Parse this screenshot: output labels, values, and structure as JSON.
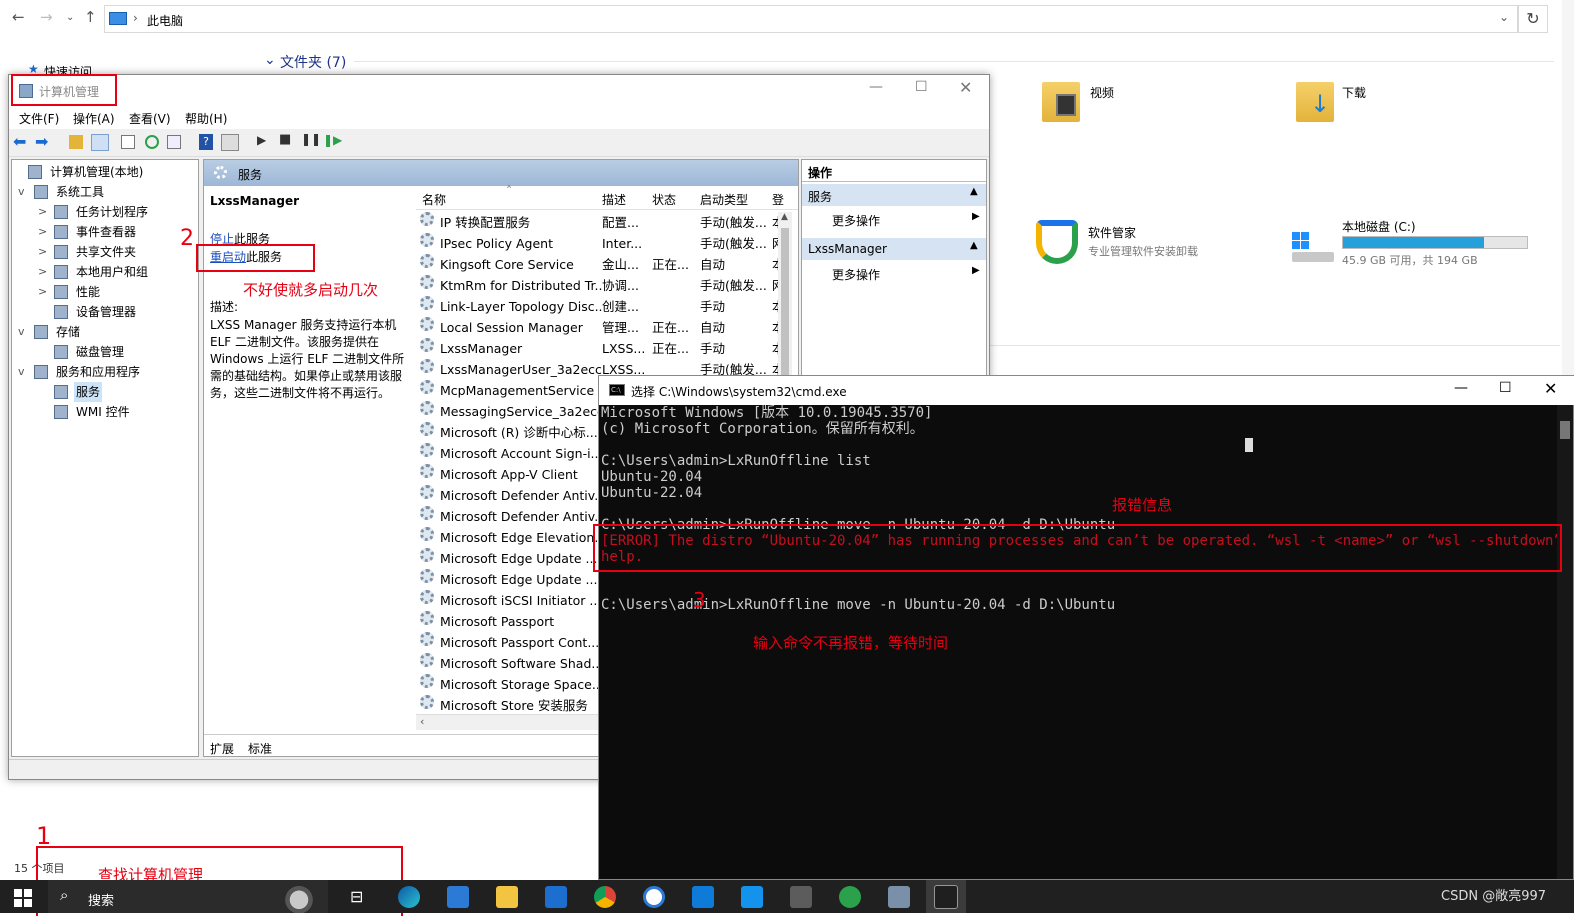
{
  "explorer": {
    "address": "此电脑",
    "folders_header": "文件夹 (7)",
    "quick_access": "快速访问",
    "items": [
      {
        "label": "视频",
        "icon": "video-folder-icon"
      },
      {
        "label": "下载",
        "icon": "download-folder-icon"
      },
      {
        "label": "软件管家",
        "sub": "专业管理软件安装卸载",
        "icon": "software-manager-icon"
      },
      {
        "label": "本地磁盘 (C:)",
        "sub": "45.9 GB 可用，共 194 GB",
        "usage_fraction": 0.764,
        "icon": "hard-disk-icon"
      }
    ],
    "status_count": "15 个项目"
  },
  "mmc": {
    "title": "计算机管理",
    "menu": [
      "文件(F)",
      "操作(A)",
      "查看(V)",
      "帮助(H)"
    ],
    "tree": [
      {
        "label": "计算机管理(本地)",
        "level": 0,
        "icon": "computer-management-icon",
        "expander": ""
      },
      {
        "label": "系统工具",
        "level": 1,
        "icon": "system-tools-icon",
        "expander": "v"
      },
      {
        "label": "任务计划程序",
        "level": 2,
        "icon": "task-scheduler-icon",
        "expander": ">"
      },
      {
        "label": "事件查看器",
        "level": 2,
        "icon": "event-viewer-icon",
        "expander": ">"
      },
      {
        "label": "共享文件夹",
        "level": 2,
        "icon": "shared-folder-icon",
        "expander": ">"
      },
      {
        "label": "本地用户和组",
        "level": 2,
        "icon": "users-icon",
        "expander": ">"
      },
      {
        "label": "性能",
        "level": 2,
        "icon": "performance-icon",
        "expander": ">"
      },
      {
        "label": "设备管理器",
        "level": 2,
        "icon": "device-manager-icon",
        "expander": ""
      },
      {
        "label": "存储",
        "level": 1,
        "icon": "storage-icon",
        "expander": "v"
      },
      {
        "label": "磁盘管理",
        "level": 2,
        "icon": "disk-management-icon",
        "expander": ""
      },
      {
        "label": "服务和应用程序",
        "level": 1,
        "icon": "services-apps-icon",
        "expander": "v"
      },
      {
        "label": "服务",
        "level": 2,
        "icon": "services-icon",
        "expander": "",
        "selected": true
      },
      {
        "label": "WMI 控件",
        "level": 2,
        "icon": "wmi-icon",
        "expander": ""
      }
    ],
    "services_header": "服务",
    "selected_service": "LxssManager",
    "stop_link": "停止",
    "stop_suffix": "此服务",
    "restart_link": "重启动",
    "restart_suffix": "此服务",
    "desc_label": "描述:",
    "desc_lines": [
      "LXSS Manager 服务支持运行本机",
      "ELF 二进制文件。该服务提供在",
      "Windows 上运行 ELF 二进制文件所",
      "需的基础结构。如果停止或禁用该服",
      "务，这些二进制文件将不再运行。"
    ],
    "columns": [
      "名称",
      "描述",
      "状态",
      "启动类型",
      "登"
    ],
    "rows": [
      [
        "IP 转换配置服务",
        "配置...",
        "",
        "手动(触发...",
        "本"
      ],
      [
        "IPsec Policy Agent",
        "Inter...",
        "",
        "手动(触发...",
        "网"
      ],
      [
        "Kingsoft Core Service",
        "金山...",
        "正在...",
        "自动",
        "本"
      ],
      [
        "KtmRm for Distributed Tr...",
        "协调...",
        "",
        "手动(触发...",
        "网"
      ],
      [
        "Link-Layer Topology Disc...",
        "创建...",
        "",
        "手动",
        "本"
      ],
      [
        "Local Session Manager",
        "管理...",
        "正在...",
        "自动",
        "本"
      ],
      [
        "LxssManager",
        "LXSS...",
        "正在...",
        "手动",
        "本"
      ],
      [
        "LxssManagerUser_3a2ecc",
        "LXSS...",
        "",
        "手动(触发...",
        "本"
      ],
      [
        "McpManagementService",
        "",
        "",
        "",
        ""
      ],
      [
        "MessagingService_3a2ecc",
        "",
        "",
        "",
        ""
      ],
      [
        "Microsoft (R) 诊断中心标...",
        "",
        "",
        "",
        ""
      ],
      [
        "Microsoft Account Sign-i...",
        "",
        "",
        "",
        ""
      ],
      [
        "Microsoft App-V Client",
        "",
        "",
        "",
        ""
      ],
      [
        "Microsoft Defender Antiv...",
        "",
        "",
        "",
        ""
      ],
      [
        "Microsoft Defender Antiv...",
        "",
        "",
        "",
        ""
      ],
      [
        "Microsoft Edge Elevation...",
        "",
        "",
        "",
        ""
      ],
      [
        "Microsoft Edge Update ...",
        "",
        "",
        "",
        ""
      ],
      [
        "Microsoft Edge Update ...",
        "",
        "",
        "",
        ""
      ],
      [
        "Microsoft iSCSI Initiator ...",
        "",
        "",
        "",
        ""
      ],
      [
        "Microsoft Passport",
        "",
        "",
        "",
        ""
      ],
      [
        "Microsoft Passport Cont...",
        "",
        "",
        "",
        ""
      ],
      [
        "Microsoft Software Shad...",
        "",
        "",
        "",
        ""
      ],
      [
        "Microsoft Storage Space...",
        "",
        "",
        "",
        ""
      ],
      [
        "Microsoft Store 安装服务",
        "",
        "",
        "",
        ""
      ]
    ],
    "tabs": [
      "扩展",
      "标准"
    ],
    "actions_header": "操作",
    "actions": [
      {
        "section": "服务",
        "item": "更多操作"
      },
      {
        "section": "LxssManager",
        "item": "更多操作"
      }
    ]
  },
  "cmd": {
    "title": "选择 C:\\Windows\\system32\\cmd.exe",
    "lines": [
      "Microsoft Windows [版本 10.0.19045.3570]",
      "(c) Microsoft Corporation。保留所有权利。",
      "",
      "C:\\Users\\admin>LxRunOffline list",
      "Ubuntu-20.04",
      "Ubuntu-22.04",
      "",
      "C:\\Users\\admin>LxRunOffline move -n Ubuntu-20.04 -d D:\\Ubuntu"
    ],
    "error_lines": [
      "[ERROR] The distro “Ubuntu-20.04” has running processes and can’t be operated. “wsl -t <name>” or “wsl --shutdown” might",
      " help."
    ],
    "last_line": "C:\\Users\\admin>LxRunOffline move -n Ubuntu-20.04 -d D:\\Ubuntu"
  },
  "annotations": {
    "n1": "1",
    "n2": "2",
    "n3": "3",
    "find_mgmt": "查找计算机管理",
    "restart_tip": "不好使就多启动几次",
    "error_info": "报错信息",
    "no_error": "输入命令不再报错，等待时间"
  },
  "taskbar": {
    "search": "搜索",
    "watermark": "CSDN @敞亮997"
  },
  "colors": {
    "accent": "#0078d7",
    "annotation_red": "#e60012",
    "error_red": "#c50f1f",
    "disk_bar": "#26a0da"
  }
}
